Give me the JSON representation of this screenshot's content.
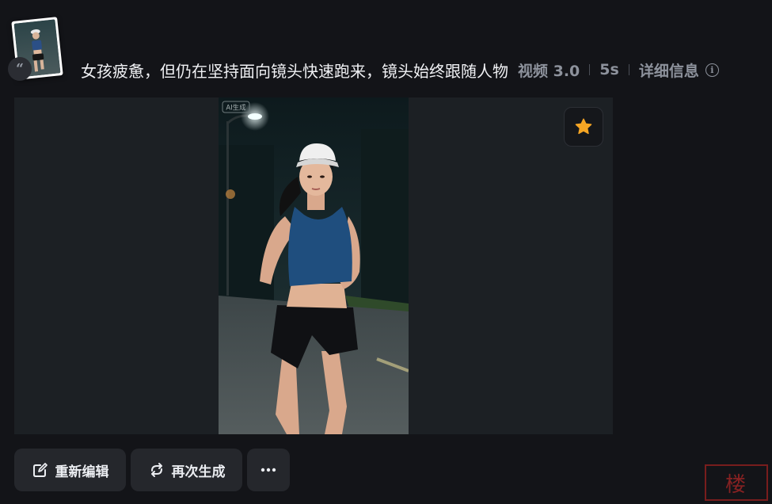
{
  "header": {
    "prompt": "女孩疲惫，但仍在坚持面向镜头快速跑来，镜头始终跟随人物",
    "model": "视频 3.0",
    "duration": "5s",
    "details_label": "详细信息"
  },
  "media": {
    "ai_tag": "AI生成"
  },
  "actions": {
    "edit_label": "重新编辑",
    "regenerate_label": "再次生成"
  },
  "icons": {
    "quote": "quote-icon",
    "info": "info-icon",
    "favorite": "star-icon",
    "edit": "edit-icon",
    "regenerate": "refresh-icon",
    "more": "more-icon"
  },
  "colors": {
    "background": "#131418",
    "button": "#25272c",
    "star": "#f5a524"
  },
  "watermark": "楼"
}
